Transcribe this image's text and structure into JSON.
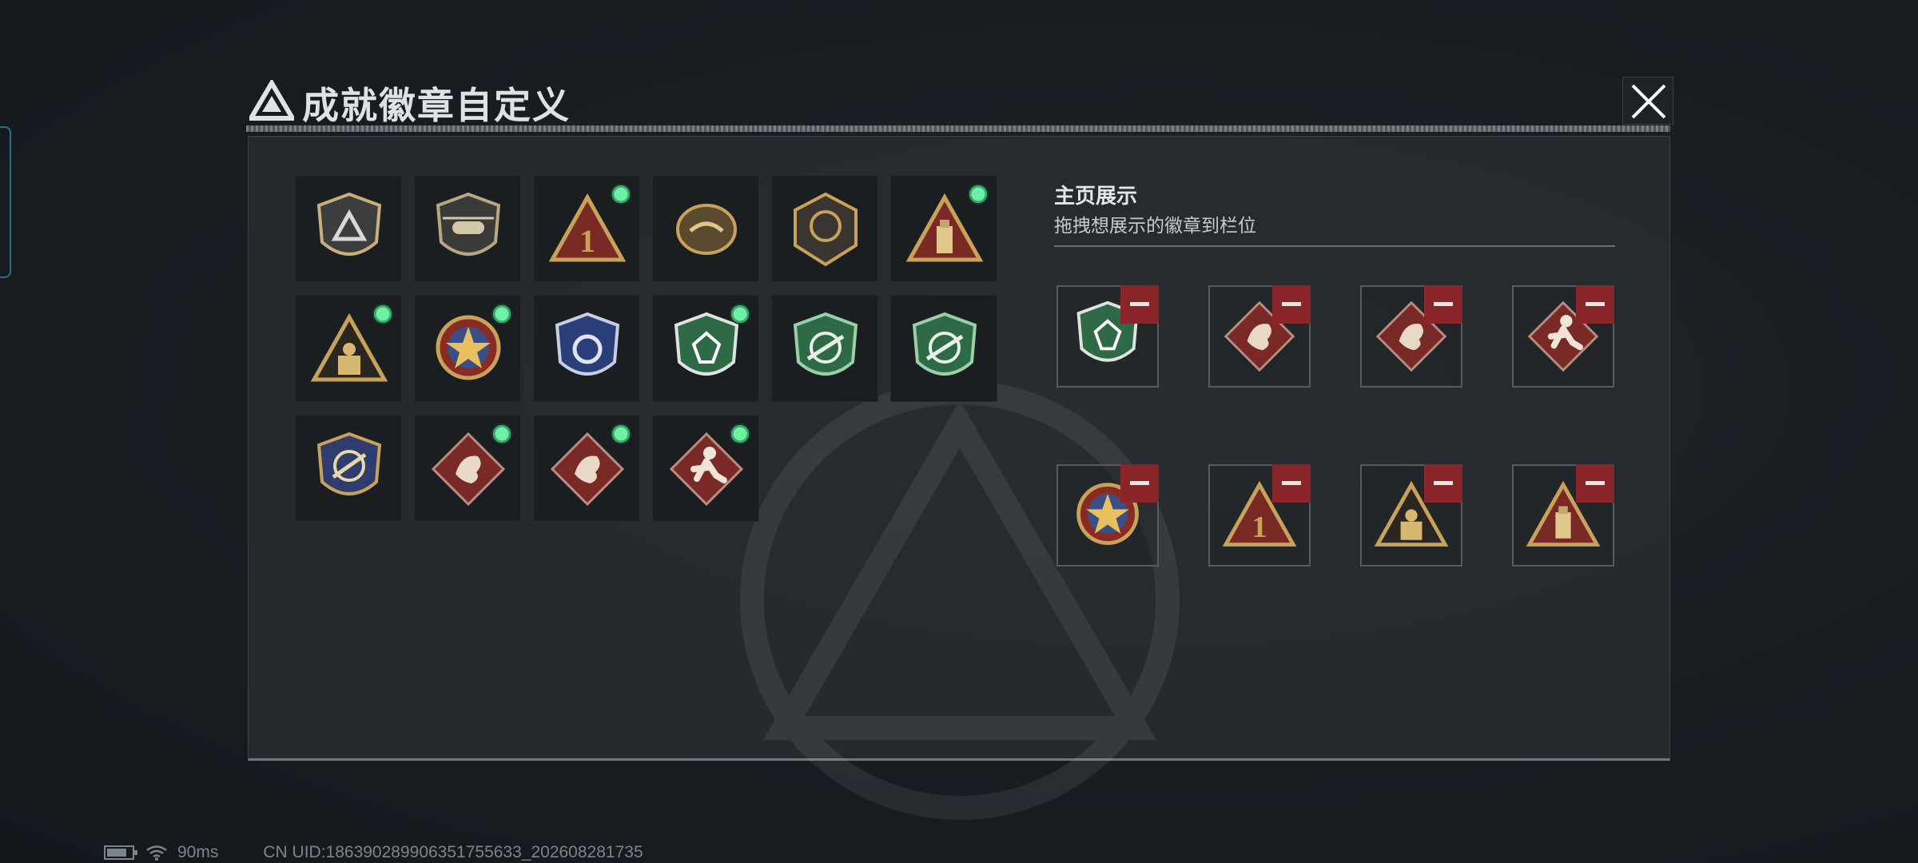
{
  "window": {
    "title": "成就徽章自定义",
    "close_icon": "close-icon",
    "logo_icon": "delta-logo-icon"
  },
  "badge_collection": {
    "badges": [
      {
        "icon": "silver-delta-shield-badge",
        "new": false
      },
      {
        "icon": "helicopter-shield-badge",
        "new": false
      },
      {
        "icon": "rank-one-triangle-badge",
        "new": true
      },
      {
        "icon": "delta-force-crest-badge",
        "new": false
      },
      {
        "icon": "delta-force-2026-badge",
        "new": false
      },
      {
        "icon": "usb-drive-triangle-badge",
        "new": true
      },
      {
        "icon": "soldiers-triangle-badge",
        "new": true
      },
      {
        "icon": "star-medal-badge",
        "new": true
      },
      {
        "icon": "blue-police-shield-badge",
        "new": false
      },
      {
        "icon": "green-gem-shield-badge",
        "new": true
      },
      {
        "icon": "green-sniper-shield-badge-1",
        "new": false
      },
      {
        "icon": "green-sniper-shield-badge-2",
        "new": false
      },
      {
        "icon": "gold-sniper-laurel-badge",
        "new": false
      },
      {
        "icon": "red-dragon-diamond-badge-1",
        "new": true
      },
      {
        "icon": "red-dragon-diamond-badge-2",
        "new": true
      },
      {
        "icon": "running-soldier-diamond-badge",
        "new": true
      }
    ]
  },
  "showcase": {
    "title": "主页展示",
    "hint": "拖拽想展示的徽章到栏位",
    "slots": [
      {
        "icon": "green-gem-shield-badge"
      },
      {
        "icon": "red-dragon-diamond-badge-1"
      },
      {
        "icon": "red-dragon-diamond-badge-2"
      },
      {
        "icon": "running-soldier-diamond-badge"
      },
      {
        "icon": "star-medal-badge"
      },
      {
        "icon": "rank-one-triangle-badge"
      },
      {
        "icon": "soldiers-triangle-badge"
      },
      {
        "icon": "usb-drive-triangle-badge"
      }
    ],
    "remove_icon": "minus-icon"
  },
  "status_bar": {
    "battery_icon": "battery-icon",
    "wifi_icon": "wifi-icon",
    "ping": "90ms",
    "uid": "CN UID:186390289906351755633_202608281735"
  },
  "colors": {
    "accent_green": "#5fe39a",
    "remove_red": "#8a262a",
    "panel_bg": "#282c30",
    "gold": "#c9a25a",
    "dragon_red": "#7a2a26",
    "shield_green": "#2f6a46"
  }
}
